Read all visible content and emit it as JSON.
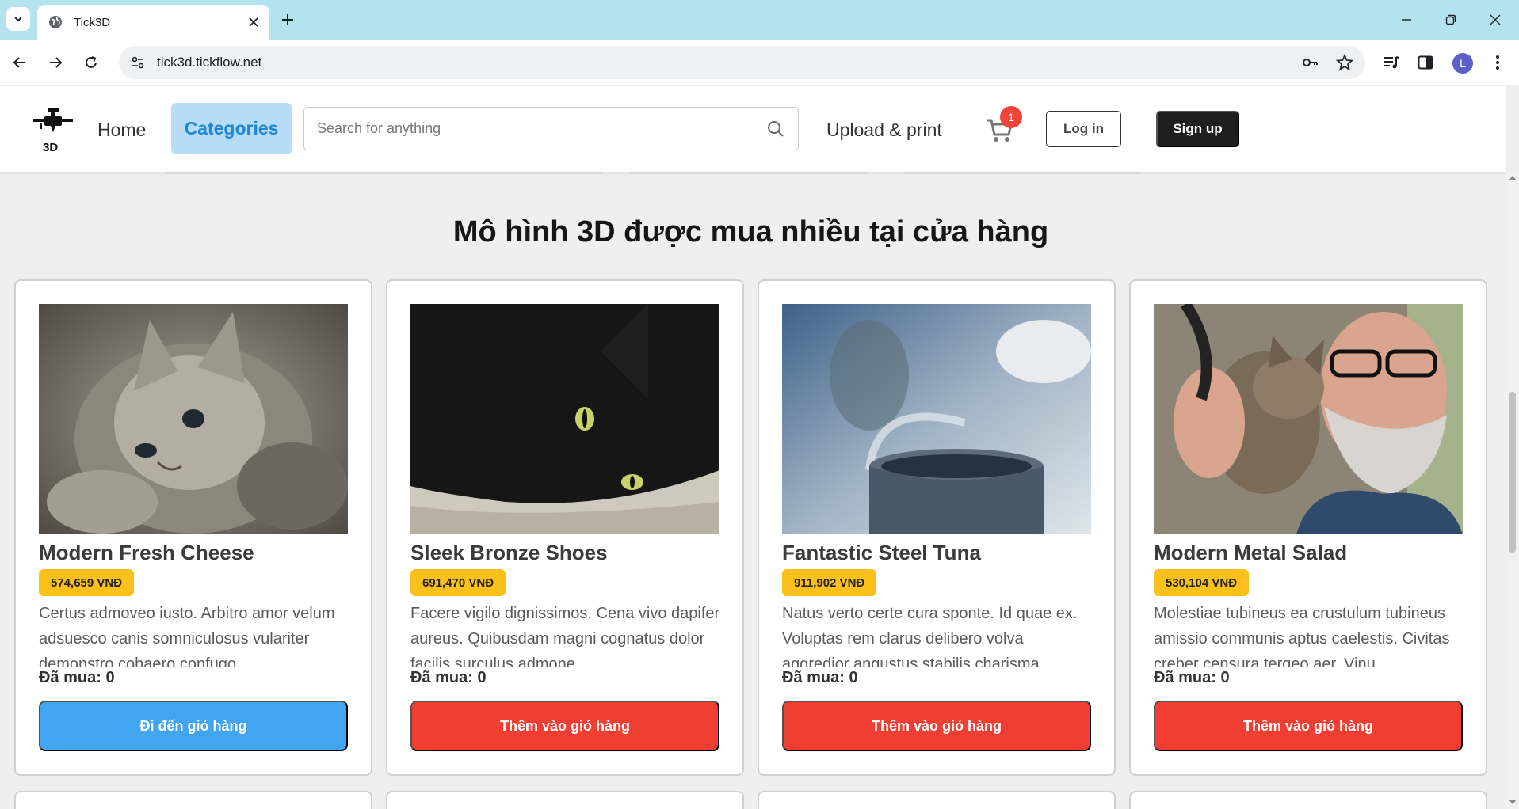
{
  "browser": {
    "tab_title": "Tick3D",
    "url": "tick3d.tickflow.net",
    "profile_initial": "L"
  },
  "header": {
    "nav": {
      "home": "Home",
      "categories": "Categories",
      "upload": "Upload & print"
    },
    "search": {
      "placeholder": "Search for anything"
    },
    "cart": {
      "count": "1"
    },
    "login_label": "Log in",
    "signup_label": "Sign up",
    "colors": {
      "active_nav_bg": "#b6dcf7",
      "active_nav_text": "#1e88d8",
      "badge": "#f04438"
    }
  },
  "section": {
    "title": "Mô hình 3D được mua nhiều tại cửa hàng"
  },
  "products": [
    {
      "name": "Modern Fresh Cheese",
      "price": "574,659 VNĐ",
      "description": "Certus admoveo iusto. Arbitro amor velum adsuesco canis somniculosus vulariter demonstro cohaero confugo....",
      "bought": "Đã mua: 0",
      "button": "Đi đến giỏ hàng",
      "button_style": "blue",
      "image": "tabby-kitten"
    },
    {
      "name": "Sleek Bronze Shoes",
      "price": "691,470 VNĐ",
      "description": "Facere vigilo dignissimos. Cena vivo dapifer aureus. Quibusdam magni cognatus dolor facilis surculus admone...",
      "bought": "Đã mua: 0",
      "button": "Thêm vào giỏ hàng",
      "button_style": "red",
      "image": "black-cat"
    },
    {
      "name": "Fantastic Steel Tuna",
      "price": "911,902 VNĐ",
      "description": "Natus verto certe cura sponte. Id quae ex. Voluptas rem clarus delibero volva aggredior angustus stabilis charisma...",
      "bought": "Đã mua: 0",
      "button": "Thêm vào giỏ hàng",
      "button_style": "red",
      "image": "steaming-cup"
    },
    {
      "name": "Modern Metal Salad",
      "price": "530,104 VNĐ",
      "description": "Molestiae tubineus ea crustulum tubineus amissio communis aptus caelestis. Civitas creber censura tergeo aer. Vinu...",
      "bought": "Đã mua: 0",
      "button": "Thêm vào giỏ hàng",
      "button_style": "red",
      "image": "man-with-kitten"
    }
  ],
  "colors": {
    "price_badge": "#fbc01a",
    "button_blue": "#42a5f0",
    "button_red": "#f13e33",
    "page_bg": "#efefef"
  }
}
